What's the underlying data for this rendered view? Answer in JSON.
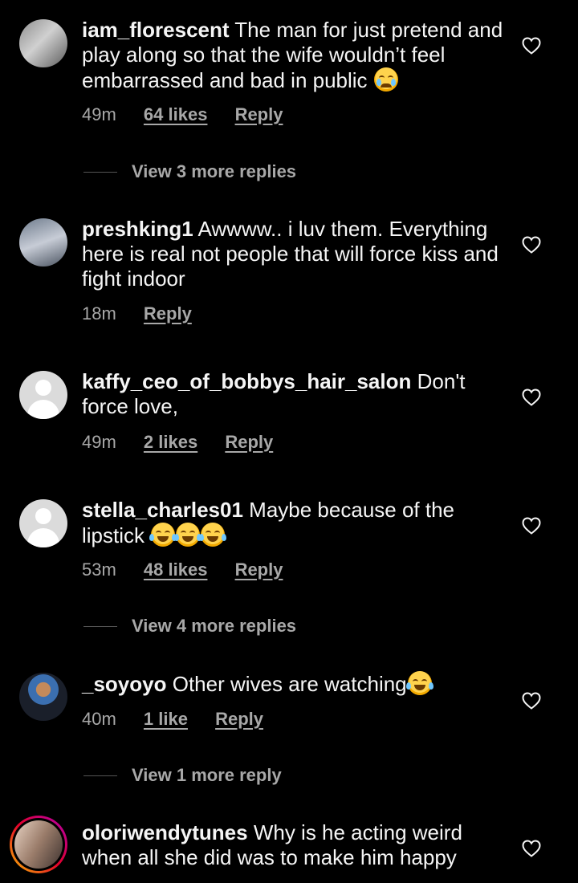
{
  "comments": [
    {
      "username": "iam_florescent",
      "text": "The man for just pretend and play along so that the wife wouldn’t feel embarrassed and bad in public",
      "time": "49m",
      "likes": "64 likes",
      "reply": "Reply",
      "view_more": "View 3 more replies"
    },
    {
      "username": "preshking1",
      "text": "Awwww.. i luv them. Everything here is real not people that will force kiss and fight indoor",
      "time": "18m",
      "reply": "Reply"
    },
    {
      "username": "kaffy_ceo_of_bobbys_hair_salon",
      "text": "Don't force love,",
      "time": "49m",
      "likes": "2 likes",
      "reply": "Reply"
    },
    {
      "username": "stella_charles01",
      "text": "Maybe because of the lipstick",
      "time": "53m",
      "likes": "48 likes",
      "reply": "Reply",
      "view_more": "View 4 more replies"
    },
    {
      "username": "_soyoyo",
      "text": "Other wives are watching",
      "time": "40m",
      "likes": "1 like",
      "reply": "Reply",
      "view_more": "View 1 more reply"
    },
    {
      "username": "oloriwendytunes",
      "text": "Why is he acting weird when all she did was to make him happy"
    }
  ],
  "icons": {
    "like": "heart-outline-icon",
    "cry_emoji": "crying-face-emoji",
    "laugh_emoji": "tears-of-joy-emoji"
  },
  "colors": {
    "background": "#000000",
    "primary_text": "#f5f5f5",
    "secondary_text": "#a8a8a8"
  }
}
